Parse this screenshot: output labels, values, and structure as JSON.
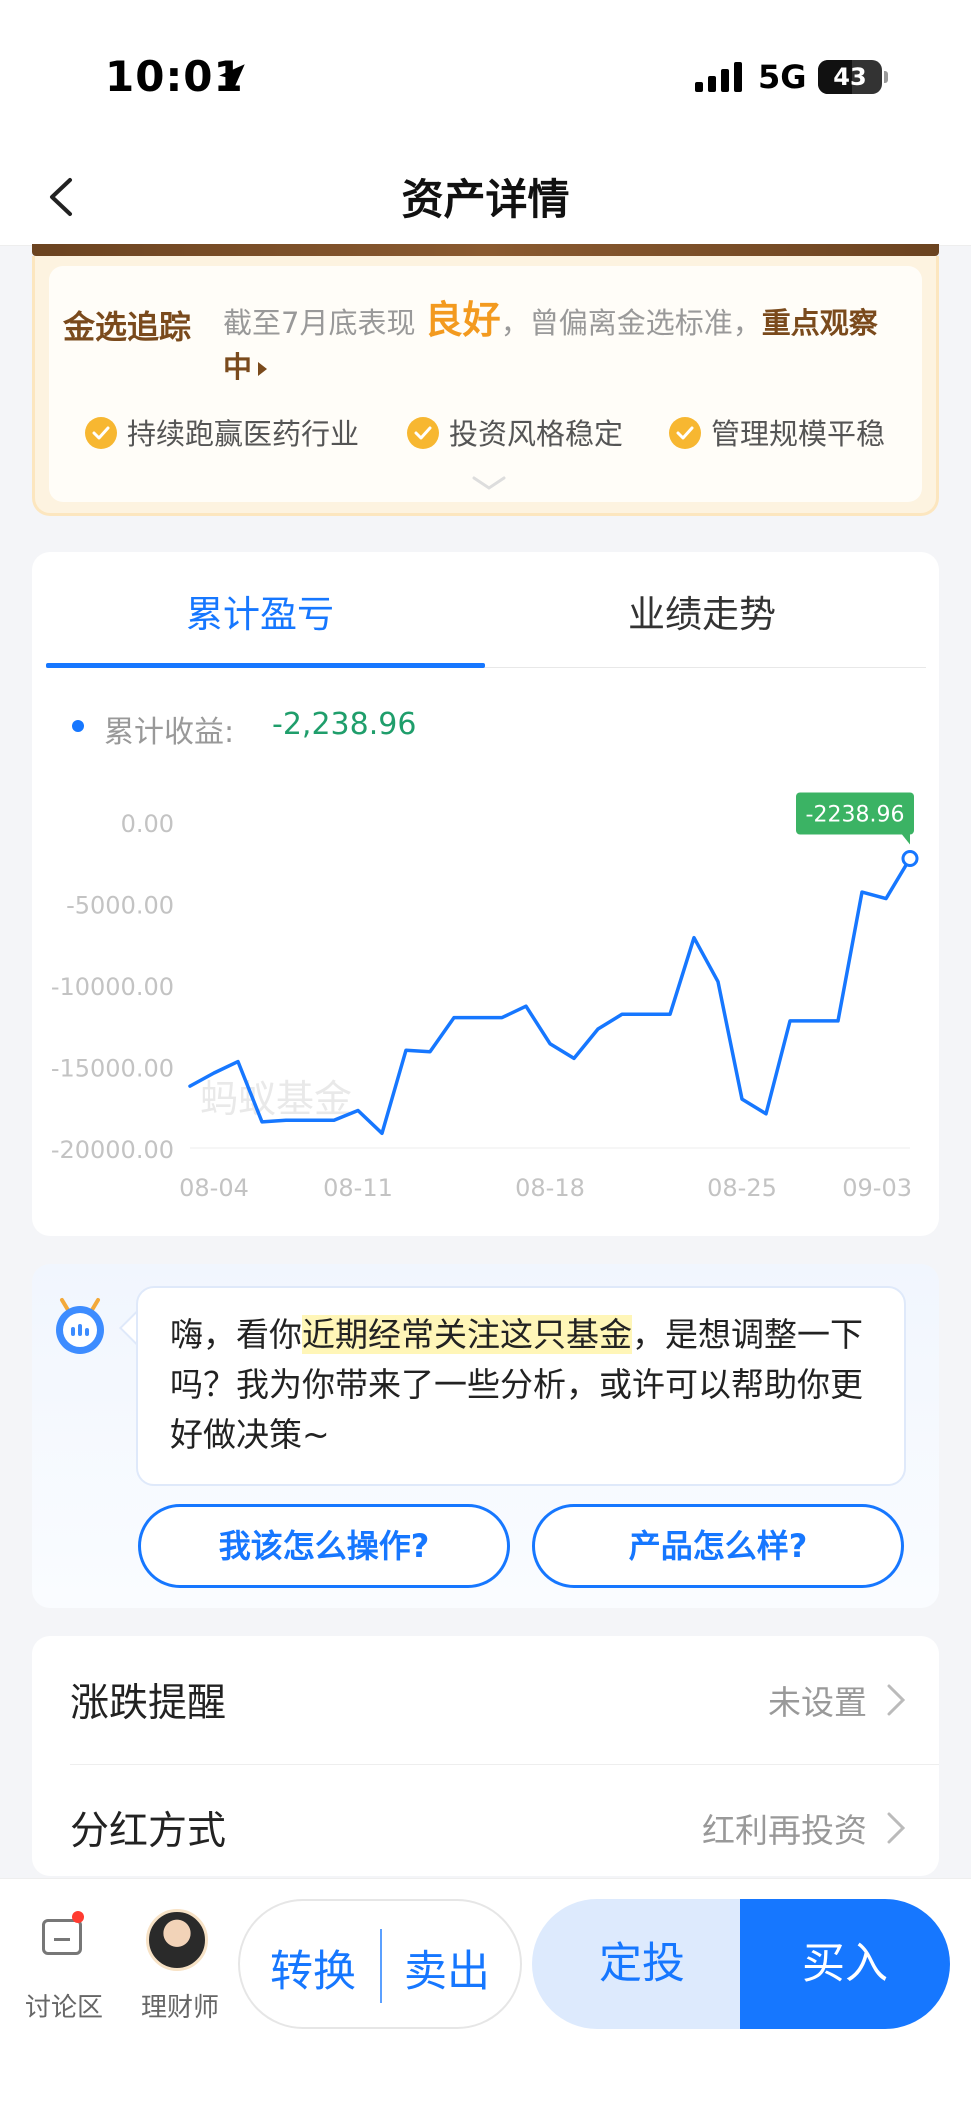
{
  "status_bar": {
    "time": "10:01",
    "network": "5G",
    "battery": "43"
  },
  "nav": {
    "title": "资产详情"
  },
  "gold_card": {
    "tag": "金选追踪",
    "text_prefix": "截至7月底表现",
    "rating": "良好",
    "text_middle": "，曾偏离金选标准，",
    "status": "重点观察中",
    "tags": [
      "持续跑赢医药行业",
      "投资风格稳定",
      "管理规模平稳"
    ]
  },
  "chart_card": {
    "tabs": [
      "累计盈亏",
      "业绩走势"
    ],
    "legend_label": "累计收益:",
    "legend_value": "-2,238.96",
    "watermark": "蚂蚁基金",
    "colors": {
      "line": "#1677ff",
      "label": "#3bb364",
      "axis_text": "#c3c3c3"
    }
  },
  "chart_data": {
    "type": "line",
    "series": [
      {
        "values": [
          -16200,
          -15400,
          -14700,
          -18400,
          -18300,
          -18300,
          -18300,
          -17700,
          -19100,
          -14000,
          -14100,
          -12000,
          -12000,
          -12000,
          -11300,
          -13600,
          -14500,
          -12700,
          -11800,
          -11800,
          -11800,
          -7100,
          -9800,
          -17000,
          -17900,
          -12200,
          -12200,
          -12200,
          -4300,
          -4700,
          -2238.96
        ]
      }
    ],
    "x_ticks": [
      "08-04",
      "08-11",
      "08-18",
      "08-25",
      "09-03"
    ],
    "y_ticks": [
      "0.00",
      "-5000.00",
      "-10000.00",
      "-15000.00",
      "-20000.00"
    ],
    "ylim": [
      -20000,
      0
    ],
    "last_value_label": "-2238.96"
  },
  "assistant": {
    "msg_part1": "嗨，看你",
    "msg_highlight": "近期经常关注这只基金",
    "msg_part2": "，是想调整一下吗？我为你带来了一些分析，或许可以帮助你更好做决策~",
    "button1": "我该怎么操作?",
    "button2": "产品怎么样?"
  },
  "settings": [
    {
      "label": "涨跌提醒",
      "value": "未设置"
    },
    {
      "label": "分红方式",
      "value": "红利再投资"
    }
  ],
  "bottom_bar": {
    "forum_label": "讨论区",
    "advisor_label": "理财师",
    "convert_label": "转换",
    "sell_label": "卖出",
    "auto_invest_label": "定投",
    "buy_label": "买入"
  }
}
